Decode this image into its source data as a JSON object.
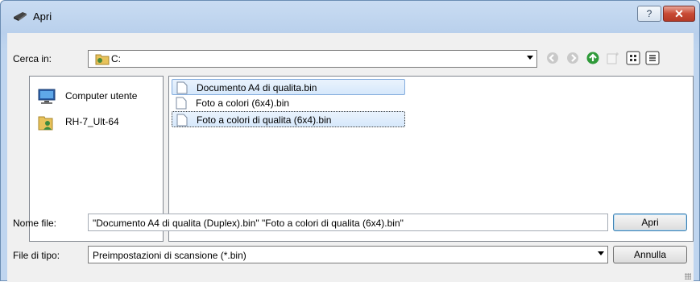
{
  "window": {
    "title": "Apri",
    "help_button": "?",
    "close_button": "✕"
  },
  "toolbar": {
    "look_in_label": "Cerca in:",
    "look_in_value": "C:",
    "icons": [
      "back-icon",
      "forward-icon",
      "up-folder-icon",
      "new-folder-icon",
      "view-tiles-icon",
      "view-details-icon"
    ]
  },
  "places": [
    {
      "label": "Computer utente",
      "icon": "computer-icon"
    },
    {
      "label": "RH-7_Ult-64",
      "icon": "user-folder-icon"
    }
  ],
  "files": [
    {
      "name": "Documento A4 di qualita.bin",
      "selected": true,
      "focused": false
    },
    {
      "name": "Foto a colori (6x4).bin",
      "selected": false,
      "focused": false
    },
    {
      "name": "Foto a colori di qualita (6x4).bin",
      "selected": true,
      "focused": true
    }
  ],
  "filename": {
    "label": "Nome file:",
    "value": "\"Documento A4 di qualita (Duplex).bin\" \"Foto a colori di qualita (6x4).bin\""
  },
  "filetype": {
    "label": "File di tipo:",
    "value": "Preimpostazioni di scansione (*.bin)"
  },
  "buttons": {
    "open": "Apri",
    "cancel": "Annulla"
  },
  "colors": {
    "title_gradient": "#c9dcf2",
    "close_button": "#c84a34",
    "selection": "#d6e8fb",
    "selection_border": "#84acdd"
  }
}
